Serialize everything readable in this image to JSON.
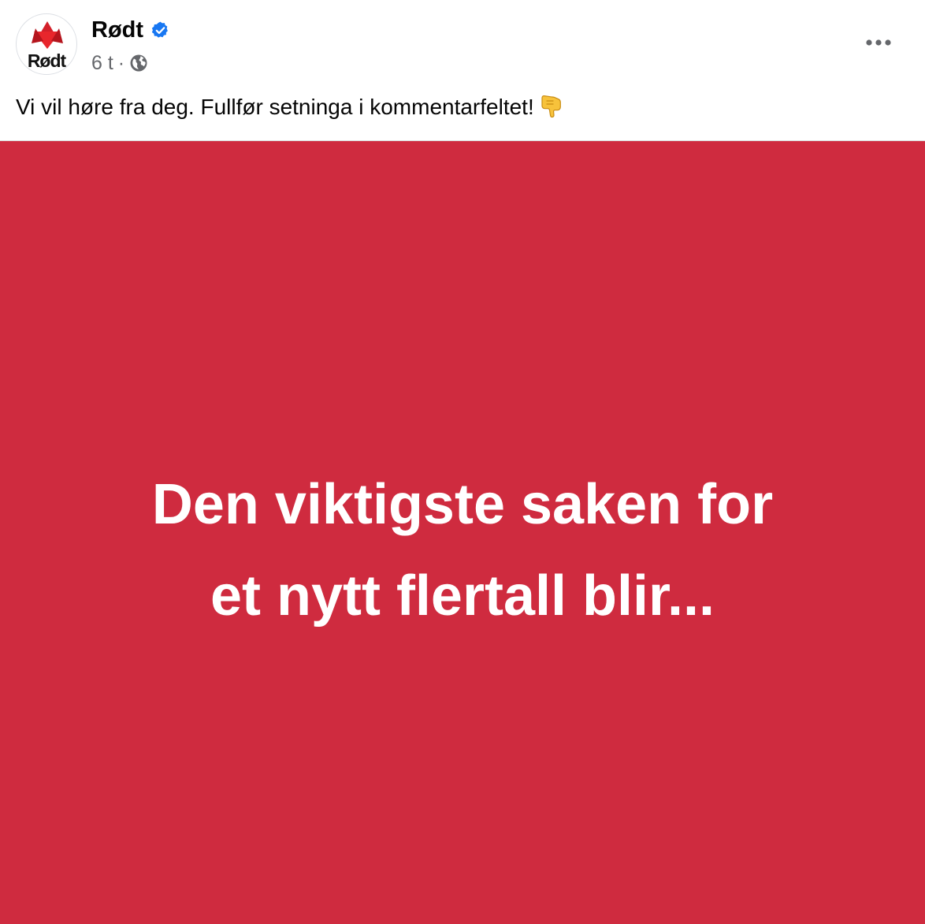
{
  "post": {
    "page_name": "Rødt",
    "avatar_text": "Rødt",
    "timestamp": "6 t",
    "separator": "·",
    "audience_icon": "globe-icon",
    "verified_icon": "verified-badge-icon",
    "more_icon": "more-options-icon",
    "caption": "Vi vil høre fra deg. Fullfør setninga i kommentarfeltet!",
    "caption_emoji_icon": "pointing-down-hand-icon",
    "media": {
      "line_1": "Den viktigste saken for",
      "line_2": "et nytt flertall blir...",
      "background_color": "#cf2b3f"
    }
  },
  "colors": {
    "verified": "#1877f2",
    "brand_red": "#d3202a",
    "meta_text": "#65676b"
  }
}
